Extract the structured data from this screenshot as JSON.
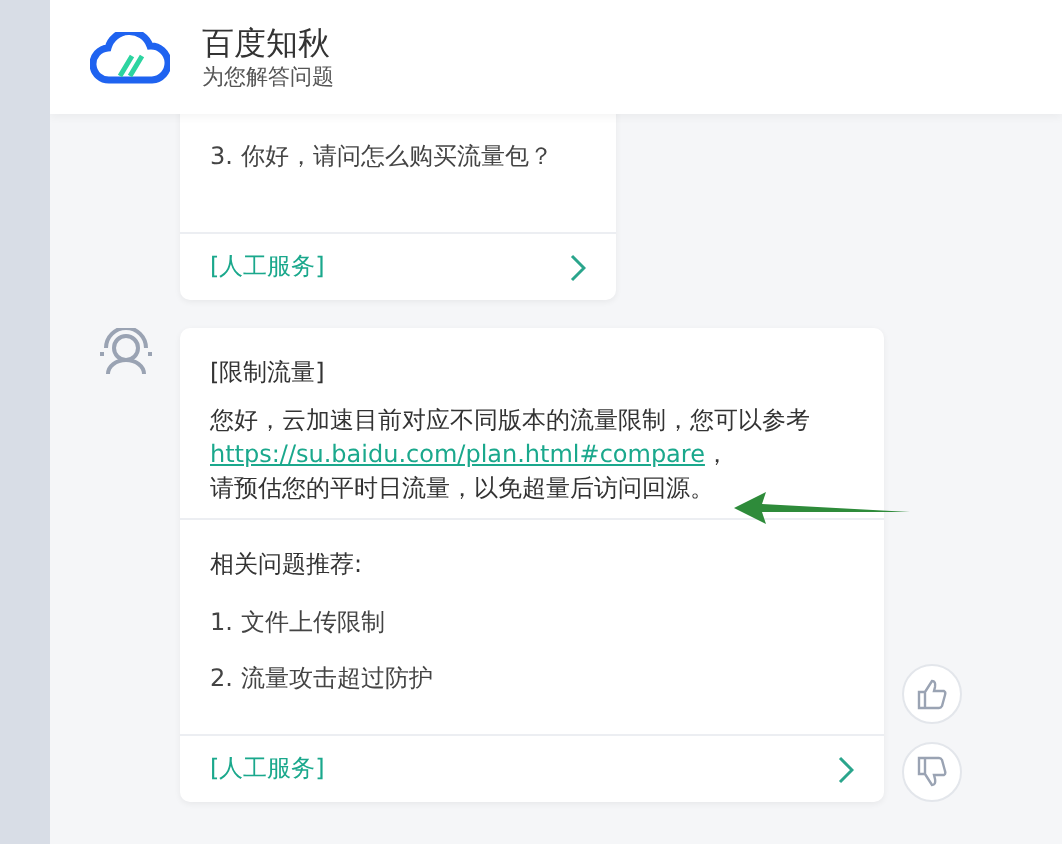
{
  "header": {
    "title": "百度知秋",
    "subtitle": "为您解答问题"
  },
  "messages": [
    {
      "related": [
        "3. 你好，请问怎么购买流量包？"
      ],
      "footer": "[人工服务]",
      "feedback": false
    },
    {
      "heading": "[限制流量]",
      "lines": [
        "您好，云加速目前对应不同版本的流量限制，您可以参考"
      ],
      "link": "https://su.baidu.com/plan.html#compare",
      "link_suffix": "，",
      "tail": "请预估您的平时日流量，以免超量后访问回源。",
      "related_title": "相关问题推荐:",
      "related": [
        "1. 文件上传限制",
        "2. 流量攻击超过防护"
      ],
      "footer": "[人工服务]",
      "feedback": true
    }
  ]
}
